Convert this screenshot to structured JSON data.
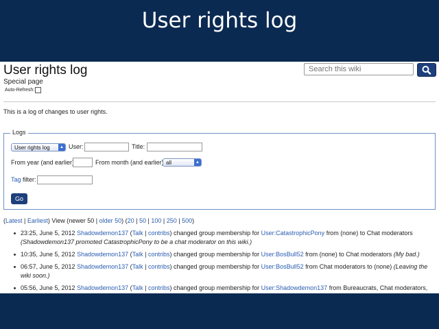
{
  "slide": {
    "title": "User rights log"
  },
  "page": {
    "title": "User rights log",
    "subtitle": "Special page",
    "auto_refresh_label": "Auto-Refresh:",
    "intro": "This is a log of changes to user rights."
  },
  "search": {
    "placeholder": "Search this wiki",
    "button_icon": "search-icon"
  },
  "logs_form": {
    "legend": "Logs",
    "log_type_value": "User rights log",
    "user_label": "User:",
    "title_label": "Title:",
    "from_year_label": "From year (and earlier):",
    "from_month_label": "From month (and earlier):",
    "month_value": "all",
    "tag_link": "Tag",
    "tag_filter_label": "filter:",
    "go_label": "Go"
  },
  "nav": {
    "open": "(",
    "latest": "Latest",
    "sep1": " | ",
    "earliest": "Earliest",
    "view_text": ") View (newer 50 | ",
    "older": "older 50",
    "mid": ") (",
    "n20": "20",
    "n50": "50",
    "n100": "100",
    "n250": "250",
    "n500": "500",
    "pipe": " | ",
    "close": ")"
  },
  "entries": [
    {
      "time": "23:25, June 5, 2012",
      "user": "Shadowdemon137",
      "talk": "Talk",
      "contribs": "contribs",
      "action": "changed group membership for",
      "target": "User:CatastrophicPony",
      "change": "from (none) to Chat moderators",
      "comment": "(Shadowdemon137 promoted CatastrophicPony to be a chat moderator on this wiki.)"
    },
    {
      "time": "10:35, June 5, 2012",
      "user": "Shadowdemon137",
      "talk": "Talk",
      "contribs": "contribs",
      "action": "changed group membership for",
      "target": "User:BosBull52",
      "change": "from (none) to Chat moderators",
      "comment": "(My bad.)"
    },
    {
      "time": "06:57, June 5, 2012",
      "user": "Shadowdemon137",
      "talk": "Talk",
      "contribs": "contribs",
      "action": "changed group membership for",
      "target": "User:BosBull52",
      "change": "from Chat moderators to (none)",
      "comment": "(Leaving the wiki soon.)"
    },
    {
      "time": "05:56, June 5, 2012",
      "user": "Shadowdemon137",
      "talk": "Talk",
      "contribs": "contribs",
      "action": "changed group membership for",
      "target": "User:Shadowdemon137",
      "change": "from Bureaucrats, Chat moderators, Facebook Connect users and Administrators to Bureaucrats, Facebook Connect users and Administrators",
      "comment": ""
    }
  ],
  "colors": {
    "background": "#0b2a52",
    "link": "#2a5db0",
    "button": "#1d3f7c",
    "fieldset_border": "#6f8fc6"
  }
}
